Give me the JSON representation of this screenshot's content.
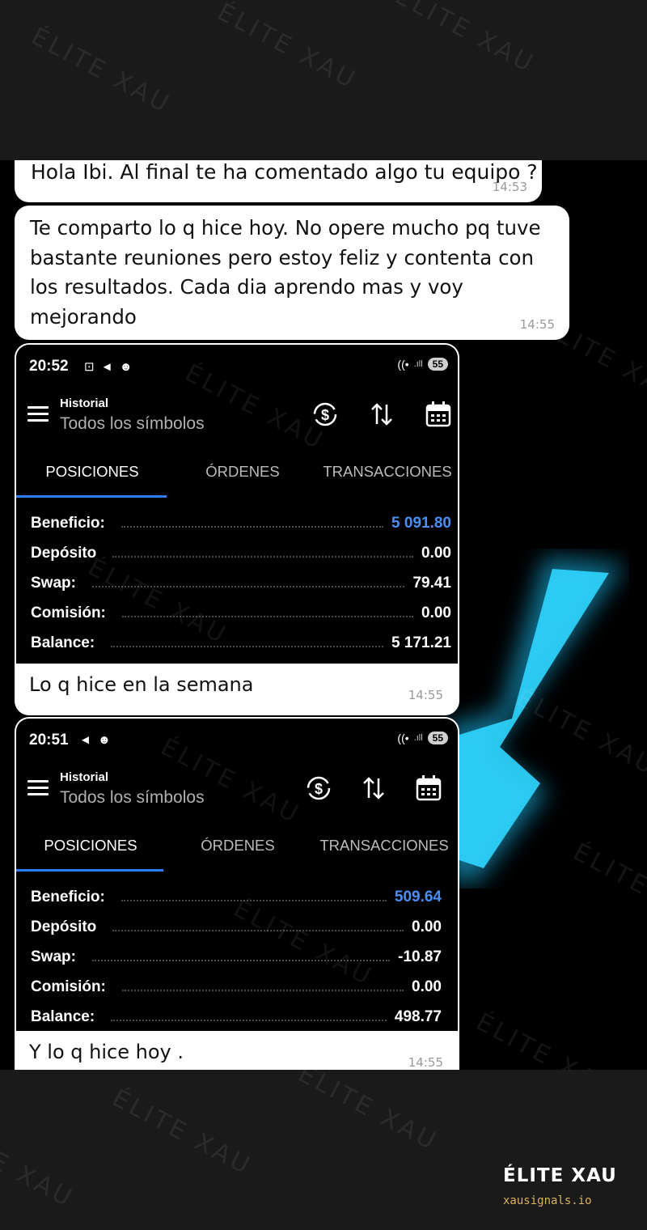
{
  "watermark": {
    "text": "ÉLITE XAU"
  },
  "brand": {
    "name": "ÉLITE XAU",
    "url": "xausignals.io"
  },
  "messages": [
    {
      "text": "Hola Ibi. Al final te ha comentado algo tu equipo ?",
      "time": "14:53"
    },
    {
      "text": "Te comparto lo q hice hoy. No opere mucho pq tuve bastante reuniones pero estoy feliz y contenta con los resultados. Cada dia aprendo mas y voy mejorando",
      "time": "14:55"
    }
  ],
  "screenshots": [
    {
      "status_time": "20:52",
      "status_icons": "⊡ ◄ ☻",
      "battery": "55",
      "app_title": "Historial",
      "app_subtitle": "Todos los símbolos",
      "tabs": [
        "POSICIONES",
        "ÓRDENES",
        "TRANSACCIONES"
      ],
      "active_tab": "POSICIONES",
      "rows": [
        {
          "label": "Beneficio:",
          "value": "5 091.80"
        },
        {
          "label": "Depósito",
          "value": "0.00"
        },
        {
          "label": "Swap:",
          "value": "79.41"
        },
        {
          "label": "Comisión:",
          "value": "0.00"
        },
        {
          "label": "Balance:",
          "value": "5 171.21"
        }
      ],
      "caption": "Lo q hice en la semana",
      "caption_time": "14:55"
    },
    {
      "status_time": "20:51",
      "status_icons": "◄ ☻",
      "battery": "55",
      "app_title": "Historial",
      "app_subtitle": "Todos los símbolos",
      "tabs": [
        "POSICIONES",
        "ÓRDENES",
        "TRANSACCIONES"
      ],
      "active_tab": "POSICIONES",
      "rows": [
        {
          "label": "Beneficio:",
          "value": "509.64"
        },
        {
          "label": "Depósito",
          "value": "0.00"
        },
        {
          "label": "Swap:",
          "value": "-10.87"
        },
        {
          "label": "Comisión:",
          "value": "0.00"
        },
        {
          "label": "Balance:",
          "value": "498.77"
        }
      ],
      "caption": "Y lo q hice hoy .",
      "caption_time": "14:55"
    }
  ],
  "colors": {
    "profit_blue": "#4a8ff5",
    "tab_indicator": "#2f7df6",
    "brand_url": "#d9b35c",
    "glow": "#1ec8ff"
  }
}
